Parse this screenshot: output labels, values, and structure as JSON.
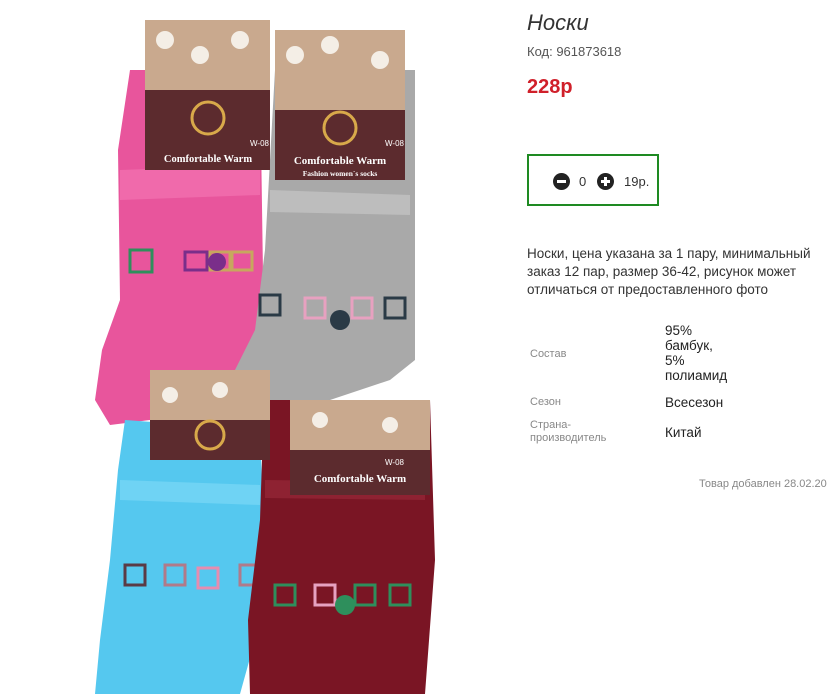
{
  "product": {
    "title": "Носки",
    "code": "Код: 961873618",
    "price": "228р",
    "quantity": "0",
    "unit_price": "19р.",
    "description": "Носки, цена указана за 1 пару, минимальный заказ 12 пар, размер 36-42, рисунок может отличаться от предоставленного фото",
    "specs": [
      {
        "label": "Состав",
        "value_lines": [
          "95%",
          "бамбук,",
          "5%",
          "полиамид"
        ]
      },
      {
        "label": "Сезон",
        "value": "Всесезон"
      },
      {
        "label_lines": [
          "Страна-",
          "производитель"
        ],
        "value": "Китай"
      }
    ],
    "added": "Товар добавлен 28.02.20"
  },
  "photo": {
    "package_text": "Comfortable Warm",
    "package_subtext": "Fashion women`s socks",
    "package_model": "W-08",
    "colors": {
      "pink": "#e8559c",
      "gray": "#a9a9a9",
      "blue": "#55c8ef",
      "burgundy": "#7a1524",
      "tag": "#5c2b2e"
    }
  },
  "colors": {
    "price": "#d0202a",
    "qty_border": "#1e8a22"
  }
}
